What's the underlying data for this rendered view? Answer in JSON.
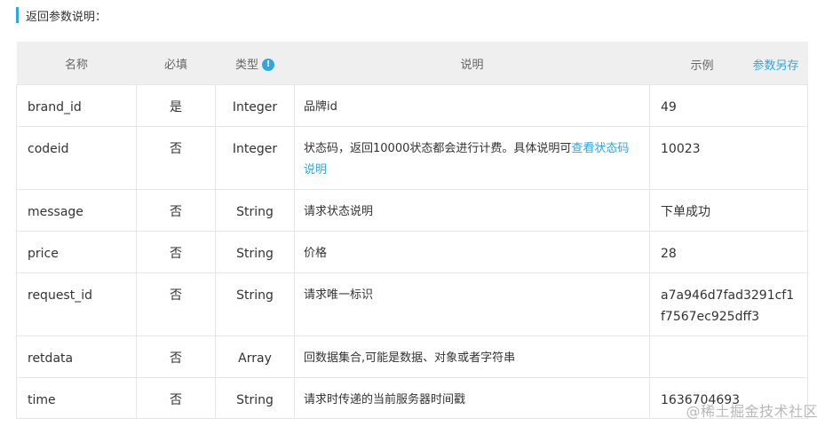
{
  "section": {
    "title": "返回参数说明："
  },
  "table": {
    "headers": {
      "name": "名称",
      "required": "必填",
      "type": "类型",
      "desc": "说明",
      "example": "示例",
      "save_link": "参数另存"
    },
    "rows": [
      {
        "name": "brand_id",
        "required": "是",
        "type": "Integer",
        "desc": "品牌id",
        "example": "49"
      },
      {
        "name": "codeid",
        "required": "否",
        "type": "Integer",
        "desc_prefix": "状态码，返回10000状态都会进行计费。具体说明可",
        "desc_link": "查看状态码说明",
        "example": "10023"
      },
      {
        "name": "message",
        "required": "否",
        "type": "String",
        "desc": "请求状态说明",
        "example": "下单成功"
      },
      {
        "name": "price",
        "required": "否",
        "type": "String",
        "desc": "价格",
        "example": "28"
      },
      {
        "name": "request_id",
        "required": "否",
        "type": "String",
        "desc": "请求唯一标识",
        "example": "a7a946d7fad3291cf1f7567ec925dff3"
      },
      {
        "name": "retdata",
        "required": "否",
        "type": "Array",
        "desc": "回数据集合,可能是数据、对象或者字符串",
        "example": ""
      },
      {
        "name": "time",
        "required": "否",
        "type": "String",
        "desc": "请求时传递的当前服务器时间戳",
        "example": "1636704693"
      }
    ]
  },
  "watermark": "@稀土掘金技术社区",
  "colors": {
    "accent": "#2ea7e0",
    "header_bg": "#efefef",
    "border": "#e6e6e6"
  }
}
